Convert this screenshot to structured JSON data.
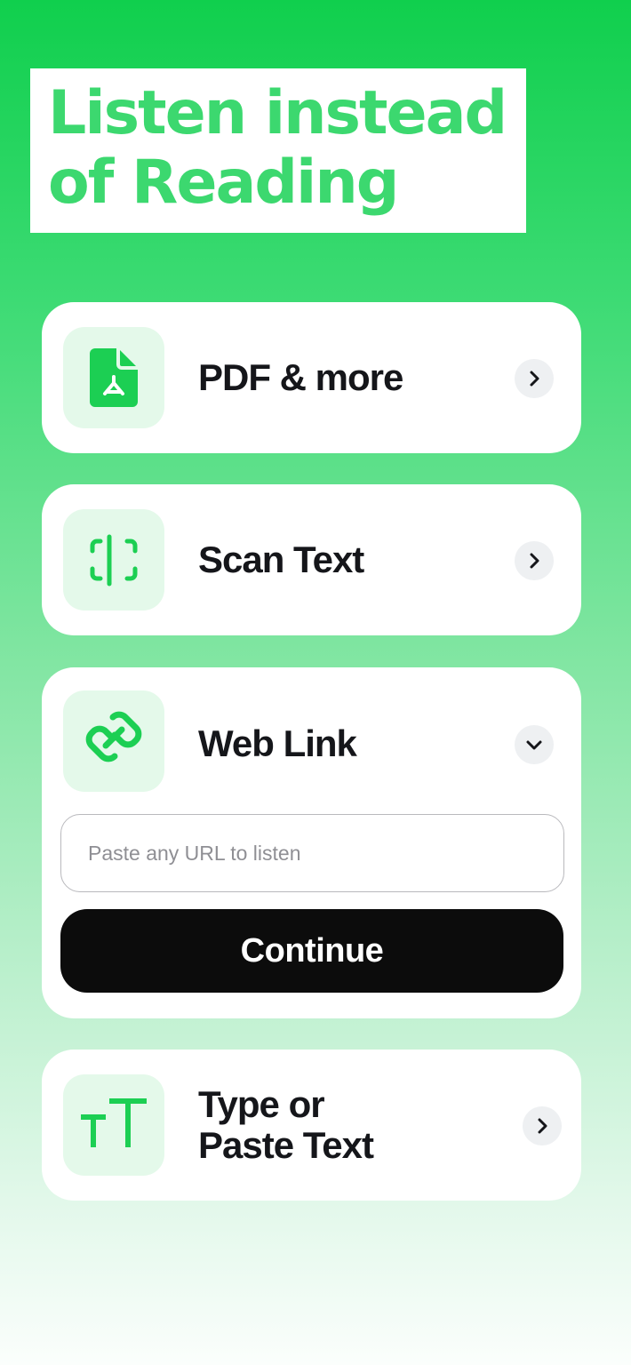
{
  "headline": {
    "line1": "Listen instead",
    "line2": "of Reading"
  },
  "options": [
    {
      "label": "PDF & more",
      "icon": "pdf-file-icon",
      "chevron": "chevron-right-icon"
    },
    {
      "label": "Scan Text",
      "icon": "scan-text-icon",
      "chevron": "chevron-right-icon"
    },
    {
      "label": "Web Link",
      "icon": "link-icon",
      "chevron": "chevron-down-icon",
      "expanded": true,
      "input_placeholder": "Paste any URL to listen",
      "input_value": "",
      "button_label": "Continue"
    },
    {
      "label_line1": "Type or",
      "label_line2": "Paste Text",
      "icon": "text-size-icon",
      "chevron": "chevron-right-icon"
    }
  ],
  "colors": {
    "accent": "#1ccf53",
    "accent_light": "#e4f9ea",
    "button": "#0c0c0c",
    "label": "#15161a"
  }
}
